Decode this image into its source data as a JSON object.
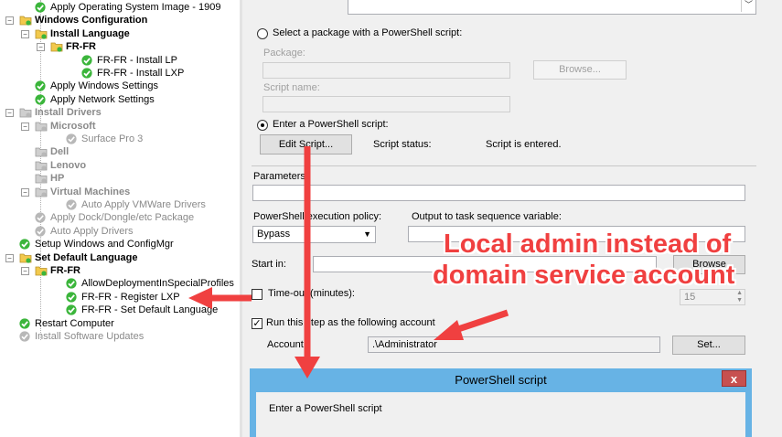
{
  "tree": {
    "items": [
      {
        "label": "Apply Operating System Image - 1909",
        "icon": "check",
        "style": "normal"
      },
      {
        "label": "Windows Configuration",
        "icon": "folder",
        "style": "bold"
      },
      {
        "label": "Install Language",
        "icon": "folder",
        "style": "bold"
      },
      {
        "label": "FR-FR",
        "icon": "folder",
        "style": "bold"
      },
      {
        "label": "FR-FR - Install LP",
        "icon": "check",
        "style": "normal"
      },
      {
        "label": "FR-FR - Install LXP",
        "icon": "check",
        "style": "normal"
      },
      {
        "label": "Apply Windows Settings",
        "icon": "check",
        "style": "normal"
      },
      {
        "label": "Apply Network Settings",
        "icon": "check",
        "style": "normal"
      },
      {
        "label": "Install Drivers",
        "icon": "folder-grey",
        "style": "bold-grey"
      },
      {
        "label": "Microsoft",
        "icon": "folder-grey",
        "style": "bold-grey"
      },
      {
        "label": "Surface Pro 3",
        "icon": "grey",
        "style": "grey"
      },
      {
        "label": "Dell",
        "icon": "folder-grey",
        "style": "bold-grey"
      },
      {
        "label": "Lenovo",
        "icon": "folder-grey",
        "style": "bold-grey"
      },
      {
        "label": "HP",
        "icon": "folder-grey",
        "style": "bold-grey"
      },
      {
        "label": "Virtual Machines",
        "icon": "folder-grey",
        "style": "bold-grey"
      },
      {
        "label": "Auto Apply VMWare Drivers",
        "icon": "grey",
        "style": "grey"
      },
      {
        "label": "Apply Dock/Dongle/etc Package",
        "icon": "grey",
        "style": "grey"
      },
      {
        "label": "Auto Apply Drivers",
        "icon": "grey",
        "style": "grey"
      },
      {
        "label": "Setup Windows and ConfigMgr",
        "icon": "check",
        "style": "normal"
      },
      {
        "label": "Set Default Language",
        "icon": "folder",
        "style": "bold"
      },
      {
        "label": "FR-FR",
        "icon": "folder",
        "style": "bold"
      },
      {
        "label": "AllowDeploymentInSpecialProfiles",
        "icon": "check",
        "style": "normal"
      },
      {
        "label": "FR-FR - Register LXP",
        "icon": "check",
        "style": "normal"
      },
      {
        "label": "FR-FR - Set Default Language",
        "icon": "check",
        "style": "normal"
      },
      {
        "label": "Restart Computer",
        "icon": "check",
        "style": "normal"
      },
      {
        "label": "Install Software Updates",
        "icon": "grey",
        "style": "grey"
      }
    ]
  },
  "props": {
    "radio_package_label": "Select a package with a PowerShell script:",
    "package_label": "Package:",
    "browse_label": "Browse...",
    "script_name_label": "Script name:",
    "radio_enter_label": "Enter a PowerShell script:",
    "edit_script_label": "Edit Script...",
    "script_status_label": "Script status:",
    "script_status_value": "Script is entered.",
    "parameters_label": "Parameters:",
    "policy_label": "PowerShell execution policy:",
    "policy_value": "Bypass",
    "output_var_label": "Output to task sequence variable:",
    "start_in_label": "Start in:",
    "browse2_label": "Browse",
    "timeout_label": "Time-out (minutes):",
    "timeout_value": "15",
    "run_as_label": "Run this step as the following account",
    "account_label": "Account:",
    "account_value": ".\\Administrator",
    "set_label": "Set..."
  },
  "annotation": {
    "line1": "Local admin instead of",
    "line2": "domain service account",
    "color": "#f04040"
  },
  "dialog": {
    "title": "PowerShell script",
    "close": "x",
    "prompt": "Enter a PowerShell script"
  }
}
